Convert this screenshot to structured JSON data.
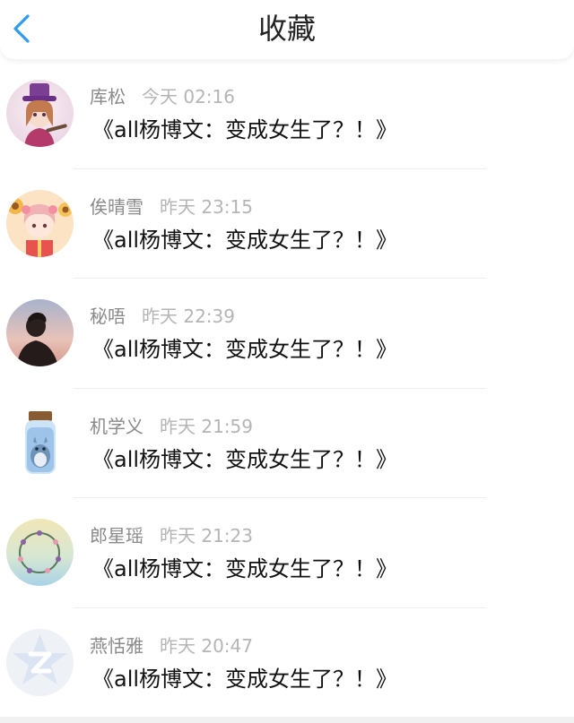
{
  "header": {
    "title": "收藏",
    "back_icon": "chevron-left-icon",
    "accent_color": "#2e9df0"
  },
  "items": [
    {
      "name": "库松",
      "time": "今天 02:16",
      "message": "《all杨博文：变成女生了？！》",
      "avatar_icon": "anime-girl-avatar-icon"
    },
    {
      "name": "俟晴雪",
      "time": "昨天 23:15",
      "message": "《all杨博文：变成女生了？！》",
      "avatar_icon": "anime-girl-flowers-avatar-icon"
    },
    {
      "name": "秘唔",
      "time": "昨天 22:39",
      "message": "《all杨博文：变成女生了？！》",
      "avatar_icon": "silhouette-sunset-avatar-icon"
    },
    {
      "name": "机学义",
      "time": "昨天 21:59",
      "message": "《all杨博文：变成女生了？！》",
      "avatar_icon": "totoro-jar-avatar-icon"
    },
    {
      "name": "郎星瑶",
      "time": "昨天 21:23",
      "message": "《all杨博文：变成女生了？！》",
      "avatar_icon": "flower-wreath-avatar-icon"
    },
    {
      "name": "燕恬雅",
      "time": "昨天 20:47",
      "message": "《all杨博文：变成女生了？！》",
      "avatar_icon": "default-star-avatar-icon"
    }
  ]
}
